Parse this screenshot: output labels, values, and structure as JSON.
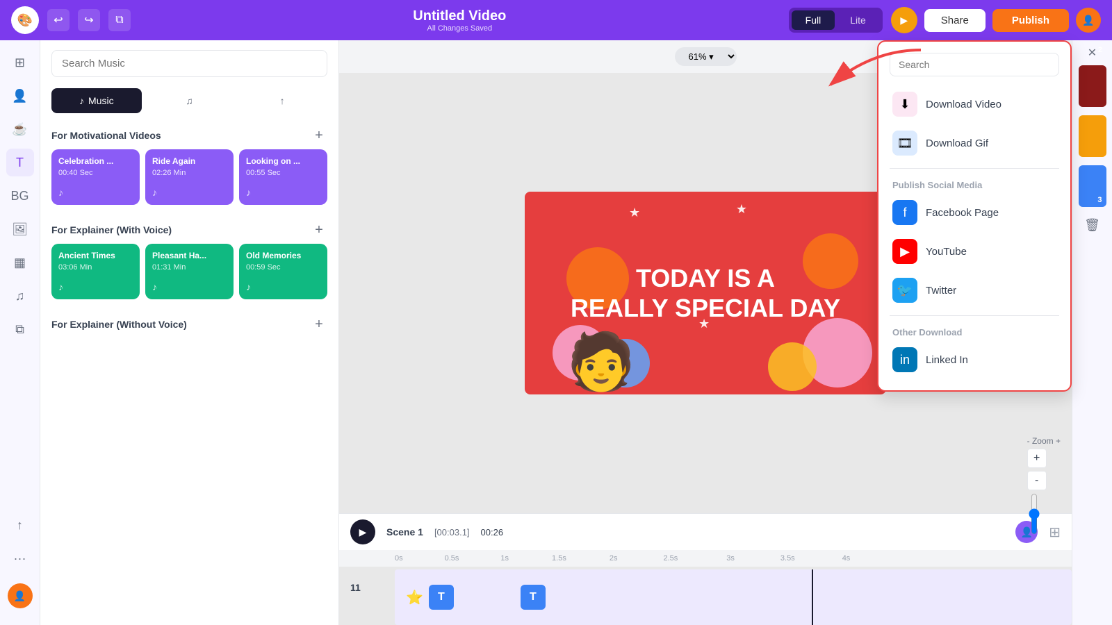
{
  "header": {
    "title": "Untitled Video",
    "subtitle": "All Changes Saved",
    "mode_full": "Full",
    "mode_lite": "Lite",
    "play_label": "▶",
    "share_label": "Share",
    "publish_label": "Publish"
  },
  "left_panel": {
    "search_placeholder": "Search Music",
    "tab_music": "Music",
    "tab_beats": "♫",
    "tab_upload": "↑",
    "section1_title": "For Motivational Videos",
    "section2_title": "For Explainer (With Voice)",
    "section3_title": "For Explainer (Without Voice)",
    "section1_cards": [
      {
        "title": "Celebration ...",
        "duration": "00:40 Sec"
      },
      {
        "title": "Ride Again",
        "duration": "02:26 Min"
      },
      {
        "title": "Looking on ...",
        "duration": "00:55 Sec"
      }
    ],
    "section2_cards": [
      {
        "title": "Ancient Times",
        "duration": "03:06 Min"
      },
      {
        "title": "Pleasant Ha...",
        "duration": "01:31 Min"
      },
      {
        "title": "Old Memories",
        "duration": "00:59 Sec"
      }
    ]
  },
  "canvas": {
    "zoom": "61%",
    "video_text_line1": "TODAY IS A",
    "video_text_line2": "REALLY SPECIAL DAY"
  },
  "playback": {
    "scene_label": "Scene 1",
    "current_time": "[00:03.1]",
    "total_time": "00:26"
  },
  "timeline": {
    "marks": [
      "0s",
      "0.5s",
      "1s",
      "1.5s",
      "2s",
      "2.5s",
      "3s",
      "3.5s",
      "4s"
    ],
    "track_number": "11"
  },
  "publish_dropdown": {
    "search_placeholder": "Search",
    "download_video_label": "Download Video",
    "download_gif_label": "Download Gif",
    "social_section_title": "Publish Social Media",
    "facebook_label": "Facebook Page",
    "youtube_label": "YouTube",
    "twitter_label": "Twitter",
    "other_section_title": "Other Download",
    "linkedin_label": "Linked In"
  },
  "zoom_controls": {
    "plus": "+",
    "minus": "-",
    "label": "- Zoom +"
  },
  "right_panel_colors": [
    "#8b1a1a",
    "#f59e0b",
    "#3b82f6"
  ]
}
